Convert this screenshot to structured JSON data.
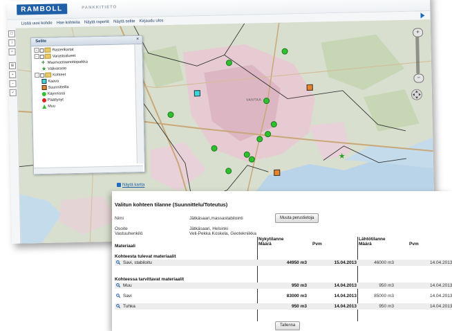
{
  "app": {
    "logo": "RAMBOLL",
    "name": "PANKKITIETO"
  },
  "menu": {
    "items": [
      "Lisää uusi kohde",
      "Hae kohteita",
      "Näytä raportit",
      "Näytä selite",
      "Kirjaudu ulos"
    ]
  },
  "legend": {
    "title": "Selite",
    "close": "×",
    "items": [
      {
        "label": "Rasterikartat",
        "level": 0,
        "symbol": "folder"
      },
      {
        "label": "Varastoalueet",
        "level": 0,
        "symbol": "folder"
      },
      {
        "label": "Maanvastaanottopaikka",
        "level": 1,
        "symbol": "plus",
        "color": "#2e8b2e"
      },
      {
        "label": "Välivarasto",
        "level": 1,
        "symbol": "star",
        "color": "#2e9b2e"
      },
      {
        "label": "Kohteet",
        "level": 0,
        "symbol": "folder"
      },
      {
        "label": "Kaava",
        "level": 1,
        "symbol": "square",
        "color": "#3ad7e0"
      },
      {
        "label": "Suunnitteilla",
        "level": 1,
        "symbol": "square",
        "color": "#e8842a"
      },
      {
        "label": "Käynnissä",
        "level": 1,
        "symbol": "circle",
        "color": "#2fbf2f"
      },
      {
        "label": "Päättynyt",
        "level": 1,
        "symbol": "circle",
        "color": "#e02020"
      },
      {
        "label": "Muu",
        "level": 1,
        "symbol": "triangle",
        "color": "#2fbf2f"
      }
    ]
  },
  "map_labels": [
    "VANTAA"
  ],
  "map_link": "Näytä kartta",
  "dialog": {
    "title": "Valitun kohteen tilanne (Suunnittelu/Toteutus)",
    "fields": [
      {
        "label": "Nimi",
        "value": "Jätkäsaari,massastabilointi"
      },
      {
        "label": "Osoite",
        "value": "Jätkäsaari, Helsinki"
      },
      {
        "label": "Vastuuhenkilö",
        "value": "Veli-Pekka Koskela, Geotekniikka"
      }
    ],
    "edit_button": "Muuta perustietoja",
    "col_material": "Materiaali",
    "current_label": "Nykytilanne",
    "start_label": "Lähtötilanne",
    "qty_label": "Määrä",
    "date_label": "Pvm",
    "section_incoming": "Kohteesta tulevat materiaalit",
    "section_needed": "Kohteessa tarvittavat materiaalit",
    "incoming": [
      {
        "name": "Savi, stabiloitu",
        "qty": "44950 m3",
        "date": "15.04.2013",
        "start_qty": "46000 m3",
        "start_date": "14.04.2013"
      }
    ],
    "needed": [
      {
        "name": "Muu",
        "qty": "950 m3",
        "date": "14.04.2013",
        "start_qty": "950 m3",
        "start_date": "14.04.2013"
      },
      {
        "name": "Savi",
        "qty": "83000 m3",
        "date": "14.04.2013",
        "start_qty": "85000 m3",
        "start_date": "14.04.2013"
      },
      {
        "name": "Tuhka",
        "qty": "950 m3",
        "date": "14.04.2013",
        "start_qty": "950 m3",
        "start_date": "14.04.2013"
      }
    ],
    "save_button": "Tallenna"
  }
}
